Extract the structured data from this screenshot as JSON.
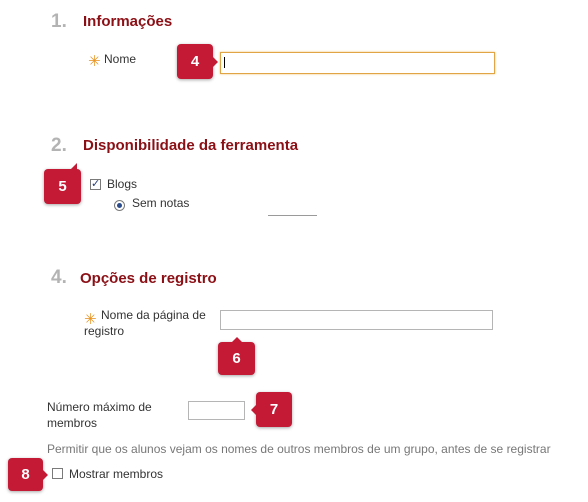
{
  "section1": {
    "number": "1.",
    "title": "Informações"
  },
  "name_field": {
    "label": "Nome",
    "value": ""
  },
  "section2": {
    "number": "2.",
    "title": "Disponibilidade da ferramenta"
  },
  "blogs": {
    "label": "Blogs",
    "checked": true
  },
  "grading": {
    "label": "Sem notas",
    "selected": true
  },
  "section4": {
    "number": "4.",
    "title": "Opções de registro"
  },
  "signup_page": {
    "label": "Nome da página de registro",
    "value": ""
  },
  "max_members": {
    "label": "Número máximo de membros",
    "value": ""
  },
  "show_members": {
    "description": "Permitir que os alunos vejam os nomes de outros membros de um grupo, antes de se registrar",
    "label": "Mostrar membros",
    "checked": false
  },
  "required_marker": "✳",
  "callouts": {
    "c4": "4",
    "c5": "5",
    "c6": "6",
    "c7": "7",
    "c8": "8"
  },
  "colors": {
    "title": "#8b1016",
    "step_number": "#b3b3b3",
    "badge": "#c41a35",
    "required": "#e8921e"
  }
}
